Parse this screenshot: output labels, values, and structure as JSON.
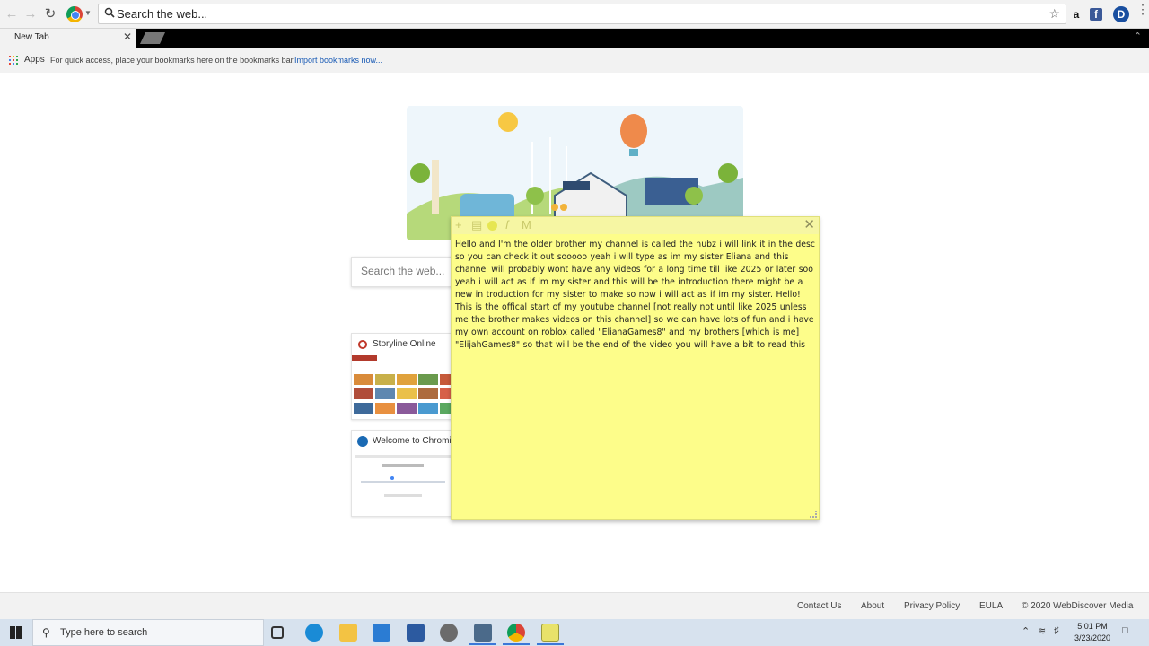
{
  "browser": {
    "omnibox_placeholder": "Search the web...",
    "tab_title": "New Tab",
    "apps_label": "Apps",
    "bookmarks_message": "For quick access, place your bookmarks here on the bookmarks bar.",
    "import_link": "Import bookmarks now...",
    "ext_amazon": "a",
    "ext_facebook": "f",
    "ext_d": "D"
  },
  "page": {
    "search_placeholder": "Search the web...",
    "tiles": [
      {
        "title": "Storyline Online"
      },
      {
        "title": "Welcome to Chromi..."
      }
    ]
  },
  "sticky_note": {
    "text": "Hello and I'm the older brother my channel is called the nubz i will link it in the desc so you can check it out sooooo yeah i will type as im my sister Eliana and this channel will probably wont have any videos for a long time till like 2025 or later soo yeah i will act as if im my sister and this will be the introduction there might be a new in troduction for my sister to make so now i will act as if im my sister. Hello! This is the offical start of my youtube channel [not really not until like 2025 unless me the brother makes videos on this channel] so we can have lots of fun and i have my own account on roblox called \"ElianaGames8\" and my brothers [which is me] \"ElijahGames8\" so that will be the end of the video you will have a bit to read this"
  },
  "footer": {
    "contact": "Contact Us",
    "about": "About",
    "privacy": "Privacy Policy",
    "eula": "EULA",
    "copyright": "© 2020 WebDiscover Media"
  },
  "taskbar": {
    "search_placeholder": "Type here to search",
    "time": "5:01 PM",
    "date": "3/23/2020"
  }
}
